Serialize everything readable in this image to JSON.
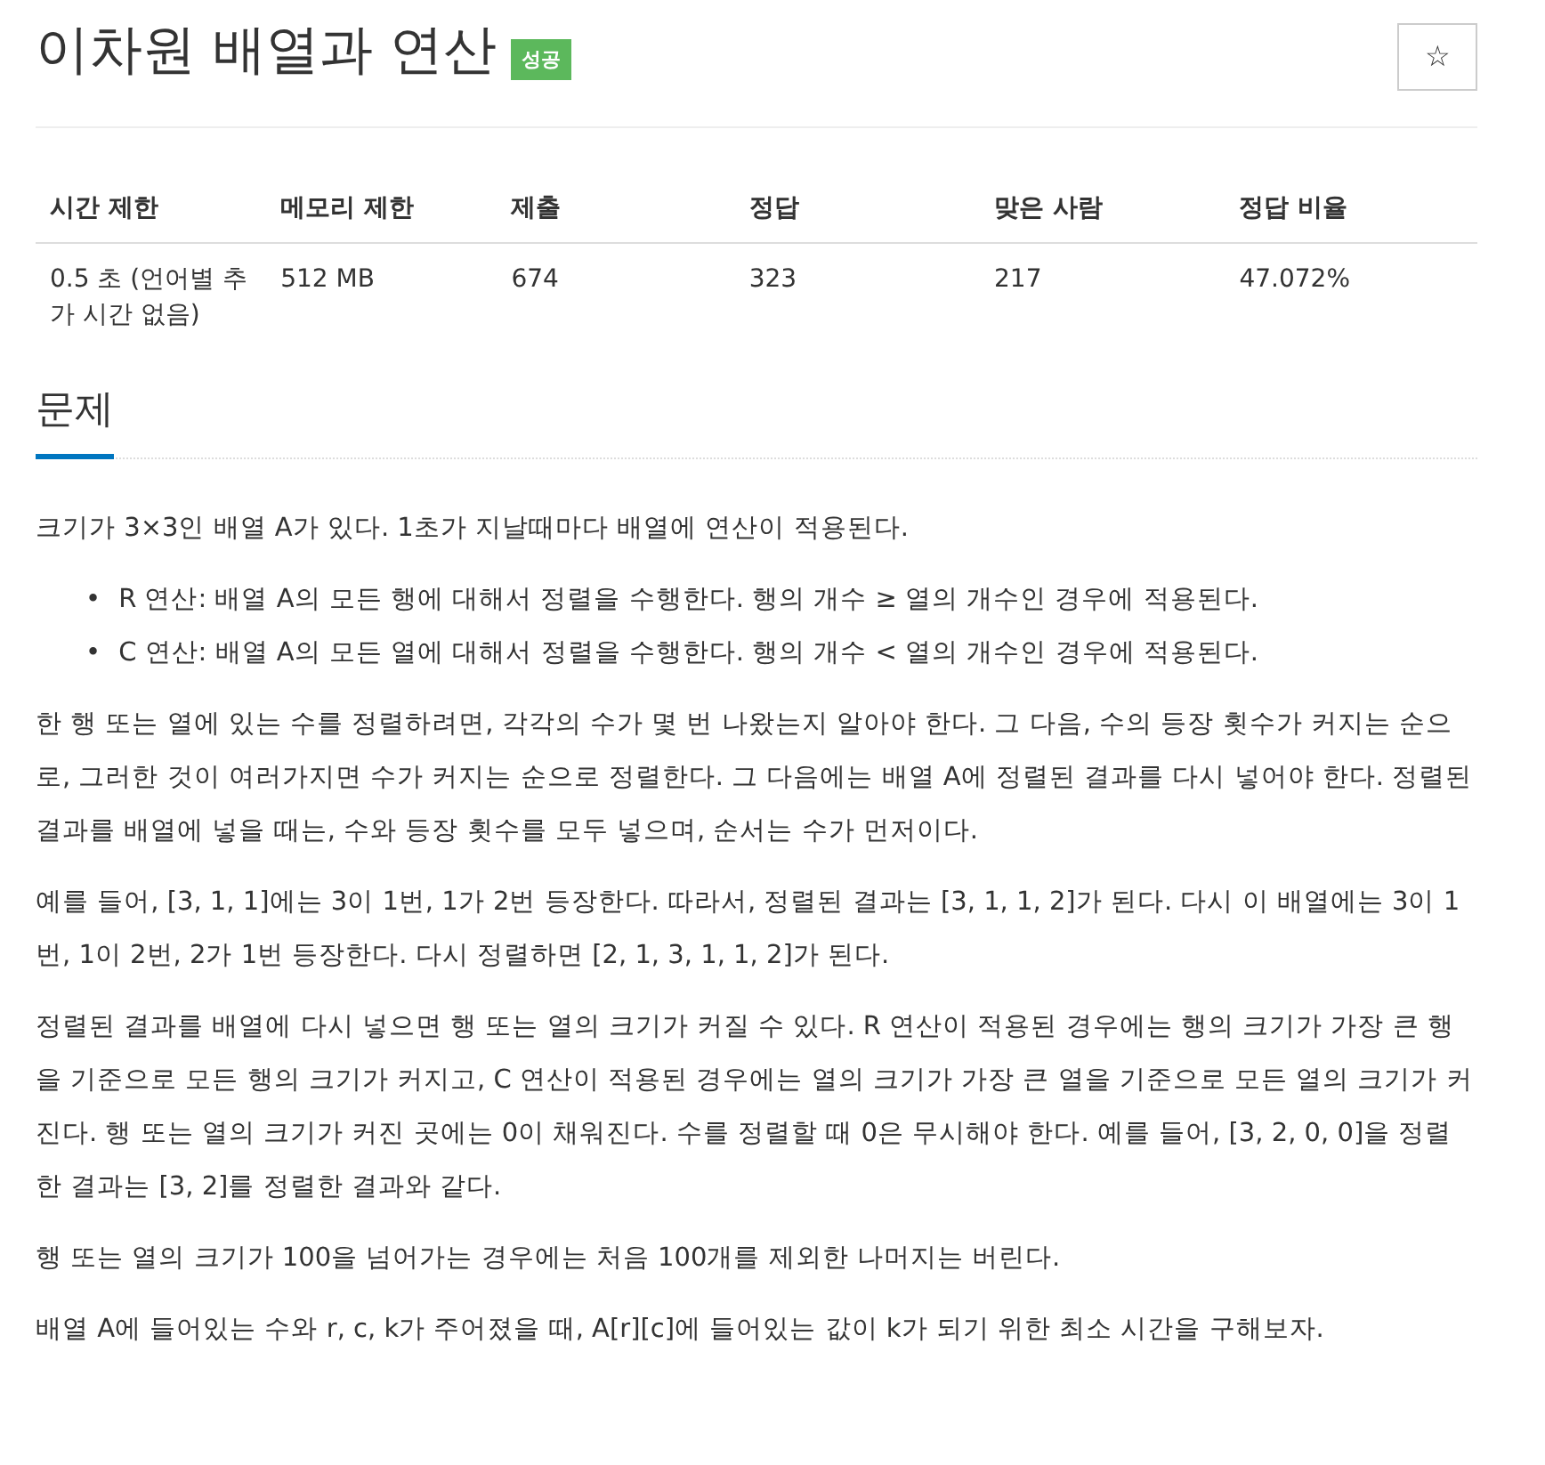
{
  "title": "이차원 배열과 연산",
  "badge": {
    "label": "성공",
    "kind": "success"
  },
  "star_button": {
    "label": "☆"
  },
  "info_table": {
    "columns": [
      "시간 제한",
      "메모리 제한",
      "제출",
      "정답",
      "맞은 사람",
      "정답 비율"
    ],
    "rows": [
      [
        "0.5 초 (언어별 추가 시간 없음)",
        "512 MB",
        "674",
        "323",
        "217",
        "47.072%"
      ]
    ]
  },
  "section": {
    "heading": "문제",
    "content": [
      {
        "kind": "paragraph",
        "text": "크기가 3×3인 배열 A가 있다. 1초가 지날때마다 배열에 연산이 적용된다."
      },
      {
        "kind": "list",
        "marker": "•",
        "items": [
          "R 연산: 배열 A의 모든 행에 대해서 정렬을 수행한다. 행의 개수 ≥ 열의 개수인 경우에 적용된다.",
          "C 연산: 배열 A의 모든 열에 대해서 정렬을 수행한다. 행의 개수 < 열의 개수인 경우에 적용된다."
        ]
      },
      {
        "kind": "paragraph",
        "text": "한 행 또는 열에 있는 수를 정렬하려면, 각각의 수가 몇 번 나왔는지 알아야 한다. 그 다음, 수의 등장 횟수가 커지는 순으로, 그러한 것이 여러가지면 수가 커지는 순으로 정렬한다. 그 다음에는 배열 A에 정렬된 결과를 다시 넣어야 한다. 정렬된 결과를 배열에 넣을 때는, 수와 등장 횟수를 모두 넣으며, 순서는 수가 먼저이다."
      },
      {
        "kind": "paragraph",
        "text": "예를 들어, [3, 1, 1]에는 3이 1번, 1가 2번 등장한다. 따라서, 정렬된 결과는 [3, 1, 1, 2]가 된다. 다시 이 배열에는 3이 1번, 1이 2번, 2가 1번 등장한다. 다시 정렬하면 [2, 1, 3, 1, 1, 2]가 된다."
      },
      {
        "kind": "paragraph",
        "text": "정렬된 결과를 배열에 다시 넣으면 행 또는 열의 크기가 커질 수 있다. R 연산이 적용된 경우에는 행의 크기가 가장 큰 행을 기준으로 모든 행의 크기가 커지고, C 연산이 적용된 경우에는 열의 크기가 가장 큰 열을 기준으로 모든 열의 크기가 커진다. 행 또는 열의 크기가 커진 곳에는 0이 채워진다. 수를 정렬할 때 0은 무시해야 한다. 예를 들어, [3, 2, 0, 0]을 정렬한 결과는 [3, 2]를 정렬한 결과와 같다."
      },
      {
        "kind": "paragraph",
        "text": "행 또는 열의 크기가 100을 넘어가는 경우에는 처음 100개를 제외한 나머지는 버린다."
      },
      {
        "kind": "paragraph",
        "text": "배열 A에 들어있는 수와 r, c, k가 주어졌을 때, A[r][c]에 들어있는 값이 k가 되기 위한 최소 시간을 구해보자."
      }
    ]
  }
}
